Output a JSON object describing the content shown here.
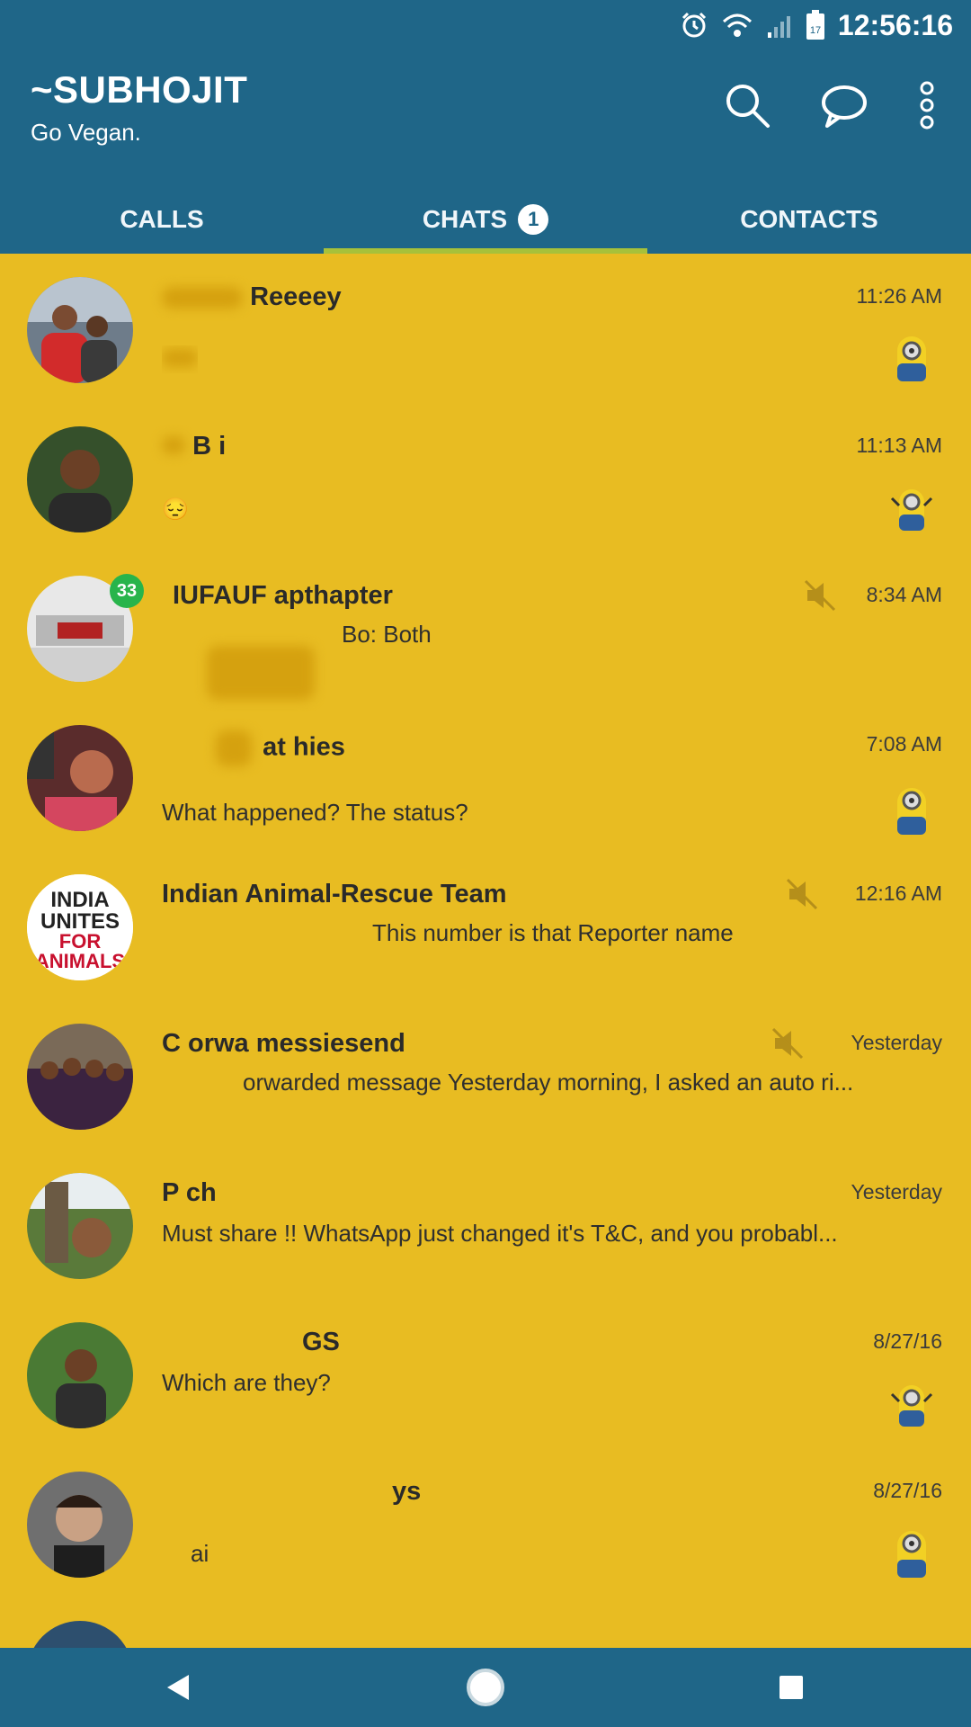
{
  "status_bar": {
    "time": "12:56:16"
  },
  "header": {
    "title": "~SUBHOJIT",
    "subtitle": "Go Vegan.",
    "tabs": [
      {
        "label": "CALLS"
      },
      {
        "label": "CHATS",
        "badge": "1"
      },
      {
        "label": "CONTACTS"
      }
    ]
  },
  "colors": {
    "bar": "#1f6688",
    "background": "#e8bc22",
    "tab_indicator": "#a7c13a",
    "unread_badge": "#28b44b"
  },
  "chats": [
    {
      "name": "Reeeey",
      "message": "",
      "time": "11:26 AM"
    },
    {
      "name": "B  i",
      "message": "",
      "time": "11:13 AM"
    },
    {
      "name": "IUFAUF apthapter",
      "message": "Bo: Both",
      "time": "8:34 AM",
      "unread": "33"
    },
    {
      "name": "at hies",
      "message": "What happened? The status?",
      "time": "7:08 AM"
    },
    {
      "name": "Indian Animal-Rescue Team",
      "message": "This number is that Reporter name",
      "time": "12:16 AM"
    },
    {
      "name": "C orwa messiesend",
      "message": "orwarded message  Yesterday morning, I asked an auto ri...",
      "time": "Yesterday"
    },
    {
      "name": "P ch",
      "message": "Must share !!   WhatsApp just changed it's T&C, and you probabl...",
      "time": "Yesterday"
    },
    {
      "name": "GS",
      "message": "Which are they?",
      "time": "8/27/16"
    },
    {
      "name": "ys",
      "message": "ai",
      "time": "8/27/16"
    }
  ],
  "icons": {
    "search": "search-icon",
    "new_chat": "chat-bubble-icon",
    "menu": "more-vert-icon",
    "mute": "muted-speaker-icon",
    "sticker": "minion-sticker-icon"
  }
}
